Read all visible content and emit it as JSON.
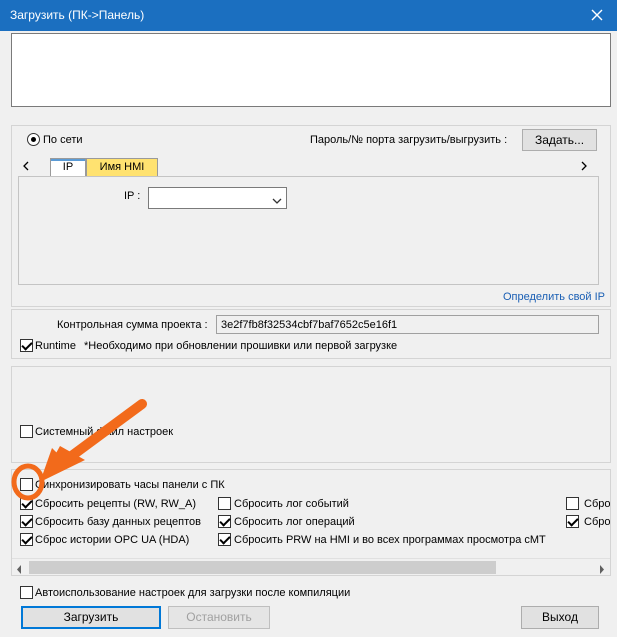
{
  "window": {
    "title": "Загрузить (ПК->Панель)"
  },
  "connection": {
    "radio_label": "По сети",
    "password_label": "Пароль/№ порта загрузить/выгрузить :",
    "set_button": "Задать..."
  },
  "tabs": [
    {
      "label": "IP",
      "color": "#ffffff"
    },
    {
      "label": "Имя HMI",
      "color": "#ffe270"
    }
  ],
  "ip": {
    "label": "IP :",
    "value": ""
  },
  "define_ip_link": "Определить свой IP",
  "checksum": {
    "label": "Контрольная сумма проекта :",
    "value": "3e2f7fb8f32534cbf7baf7652c5e16f1"
  },
  "runtime": {
    "label": "Runtime",
    "checked": true,
    "note": "*Необходимо при обновлении прошивки или первой загрузке"
  },
  "system_settings": {
    "label": "Системный файл настроек",
    "checked": false
  },
  "options": {
    "sync_clock": {
      "label": "Синхронизировать часы панели с ПК",
      "checked": false
    },
    "col1": [
      {
        "label": "Сбросить рецепты (RW, RW_A)",
        "checked": true
      },
      {
        "label": "Сбросить базу данных рецептов",
        "checked": true
      },
      {
        "label": "Сброс истории OPC UA (HDA)",
        "checked": true
      }
    ],
    "col2": [
      {
        "label": "Сбросить лог событий",
        "checked": false
      },
      {
        "label": "Сбросить лог операций",
        "checked": true
      },
      {
        "label": "Сбросить PRW на HMI и во всех программах просмотра cMT",
        "checked": true
      }
    ],
    "col3": [
      {
        "label": "Сбро",
        "checked": false
      },
      {
        "label": "Сбро",
        "checked": true
      }
    ]
  },
  "auto_use": {
    "label": "Автоиспользование настроек для загрузки после компиляции",
    "checked": false
  },
  "buttons": {
    "download": "Загрузить",
    "stop": "Остановить",
    "exit": "Выход"
  },
  "annotation": {
    "color": "#f26a1b"
  }
}
